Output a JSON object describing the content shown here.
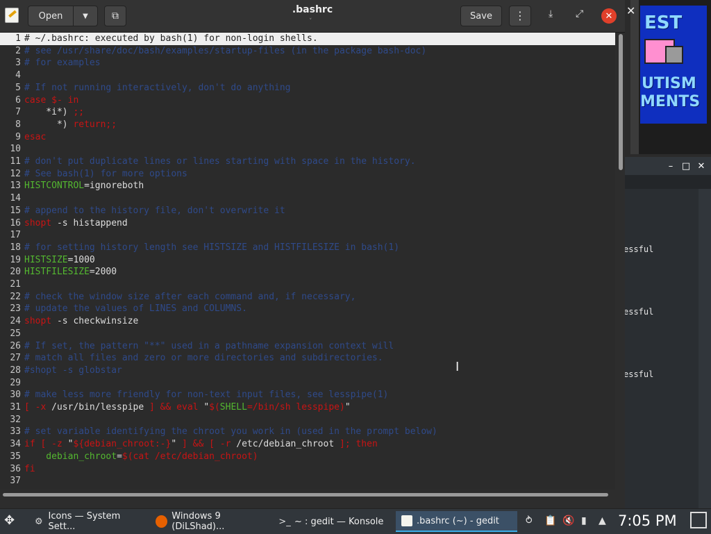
{
  "window": {
    "title": ".bashrc",
    "open_label": "Open",
    "save_label": "Save"
  },
  "editor": {
    "lines": [
      {
        "n": "1",
        "segs": [
          {
            "t": "# ~/.bashrc: executed by bash(1) for non-login shells.",
            "k": "c"
          }
        ],
        "current": true
      },
      {
        "n": "2",
        "segs": [
          {
            "t": "# see /usr/share/doc/bash/examples/startup-files (in the package bash-doc)",
            "k": "c"
          }
        ]
      },
      {
        "n": "3",
        "segs": [
          {
            "t": "# for examples",
            "k": "c"
          }
        ]
      },
      {
        "n": "4",
        "segs": []
      },
      {
        "n": "5",
        "segs": [
          {
            "t": "# If not running interactively, don't do anything",
            "k": "c"
          }
        ]
      },
      {
        "n": "6",
        "segs": [
          {
            "t": "case $- in",
            "k": "kw"
          }
        ]
      },
      {
        "n": "7",
        "segs": [
          {
            "t": "    *i*) ",
            "k": "code"
          },
          {
            "t": ";;",
            "k": "kw"
          }
        ]
      },
      {
        "n": "8",
        "segs": [
          {
            "t": "      *) ",
            "k": "code"
          },
          {
            "t": "return;;",
            "k": "kw"
          }
        ]
      },
      {
        "n": "9",
        "segs": [
          {
            "t": "esac",
            "k": "kw"
          }
        ]
      },
      {
        "n": "10",
        "segs": []
      },
      {
        "n": "11",
        "segs": [
          {
            "t": "# don't put duplicate lines or lines starting with space in the history.",
            "k": "c"
          }
        ]
      },
      {
        "n": "12",
        "segs": [
          {
            "t": "# See bash(1) for more options",
            "k": "c"
          }
        ]
      },
      {
        "n": "13",
        "segs": [
          {
            "t": "HISTCONTROL",
            "k": "var"
          },
          {
            "t": "=ignoreboth",
            "k": "code"
          }
        ]
      },
      {
        "n": "14",
        "segs": []
      },
      {
        "n": "15",
        "segs": [
          {
            "t": "# append to the history file, don't overwrite it",
            "k": "c"
          }
        ]
      },
      {
        "n": "16",
        "segs": [
          {
            "t": "shopt",
            "k": "kw"
          },
          {
            "t": " -s histappend",
            "k": "code"
          }
        ]
      },
      {
        "n": "17",
        "segs": []
      },
      {
        "n": "18",
        "segs": [
          {
            "t": "# for setting history length see HISTSIZE and HISTFILESIZE in bash(1)",
            "k": "c"
          }
        ]
      },
      {
        "n": "19",
        "segs": [
          {
            "t": "HISTSIZE",
            "k": "var"
          },
          {
            "t": "=1000",
            "k": "code"
          }
        ]
      },
      {
        "n": "20",
        "segs": [
          {
            "t": "HISTFILESIZE",
            "k": "var"
          },
          {
            "t": "=2000",
            "k": "code"
          }
        ]
      },
      {
        "n": "21",
        "segs": []
      },
      {
        "n": "22",
        "segs": [
          {
            "t": "# check the window size after each command and, if necessary,",
            "k": "c"
          }
        ]
      },
      {
        "n": "23",
        "segs": [
          {
            "t": "# update the values of LINES and COLUMNS.",
            "k": "c"
          }
        ]
      },
      {
        "n": "24",
        "segs": [
          {
            "t": "shopt",
            "k": "kw"
          },
          {
            "t": " -s checkwinsize",
            "k": "code"
          }
        ]
      },
      {
        "n": "25",
        "segs": []
      },
      {
        "n": "26",
        "segs": [
          {
            "t": "# If set, the pattern \"**\" used in a pathname expansion context will",
            "k": "c"
          }
        ]
      },
      {
        "n": "27",
        "segs": [
          {
            "t": "# match all files and zero or more directories and subdirectories.",
            "k": "c"
          }
        ]
      },
      {
        "n": "28",
        "segs": [
          {
            "t": "#shopt -s globstar",
            "k": "c"
          }
        ]
      },
      {
        "n": "29",
        "segs": []
      },
      {
        "n": "30",
        "segs": [
          {
            "t": "# make less more friendly for non-text input files, see lesspipe(1)",
            "k": "c"
          }
        ]
      },
      {
        "n": "31",
        "segs": [
          {
            "t": "[ -x",
            "k": "kw"
          },
          {
            "t": " /usr/bin/lesspipe ",
            "k": "code"
          },
          {
            "t": "] && eval ",
            "k": "kw"
          },
          {
            "t": "\"",
            "k": "code"
          },
          {
            "t": "$(",
            "k": "kw"
          },
          {
            "t": "SHELL",
            "k": "var"
          },
          {
            "t": "=/bin/sh lesspipe)",
            "k": "kw"
          },
          {
            "t": "\"",
            "k": "code"
          }
        ]
      },
      {
        "n": "32",
        "segs": []
      },
      {
        "n": "33",
        "segs": [
          {
            "t": "# set variable identifying the chroot you work in (used in the prompt below)",
            "k": "c"
          }
        ]
      },
      {
        "n": "34",
        "segs": [
          {
            "t": "if [ -z ",
            "k": "kw"
          },
          {
            "t": "\"",
            "k": "code"
          },
          {
            "t": "${debian_chroot:-}",
            "k": "kw"
          },
          {
            "t": "\"",
            "k": "code"
          },
          {
            "t": " ] && [ -r",
            "k": "kw"
          },
          {
            "t": " /etc/debian_chroot ",
            "k": "code"
          },
          {
            "t": "]; then",
            "k": "kw"
          }
        ]
      },
      {
        "n": "35",
        "segs": [
          {
            "t": "    debian_chroot",
            "k": "var"
          },
          {
            "t": "=",
            "k": "code"
          },
          {
            "t": "$(cat /etc/debian_chroot)",
            "k": "kw"
          }
        ]
      },
      {
        "n": "36",
        "segs": [
          {
            "t": "fi",
            "k": "kw"
          }
        ]
      },
      {
        "n": "37",
        "segs": []
      }
    ]
  },
  "konsole_bg": {
    "lines": [
      "essful",
      "essful",
      "essful"
    ]
  },
  "taskbar": {
    "tasks": [
      {
        "label": "Icons — System Sett...",
        "icon": "settings-icon"
      },
      {
        "label": "Windows 9 (DiLShad)...",
        "icon": "firefox-icon"
      },
      {
        "label": "~ : gedit — Konsole",
        "icon": "terminal-icon"
      },
      {
        "label": ".bashrc (~) - gedit",
        "icon": "gedit-icon"
      }
    ],
    "clock": "7:05 PM"
  }
}
